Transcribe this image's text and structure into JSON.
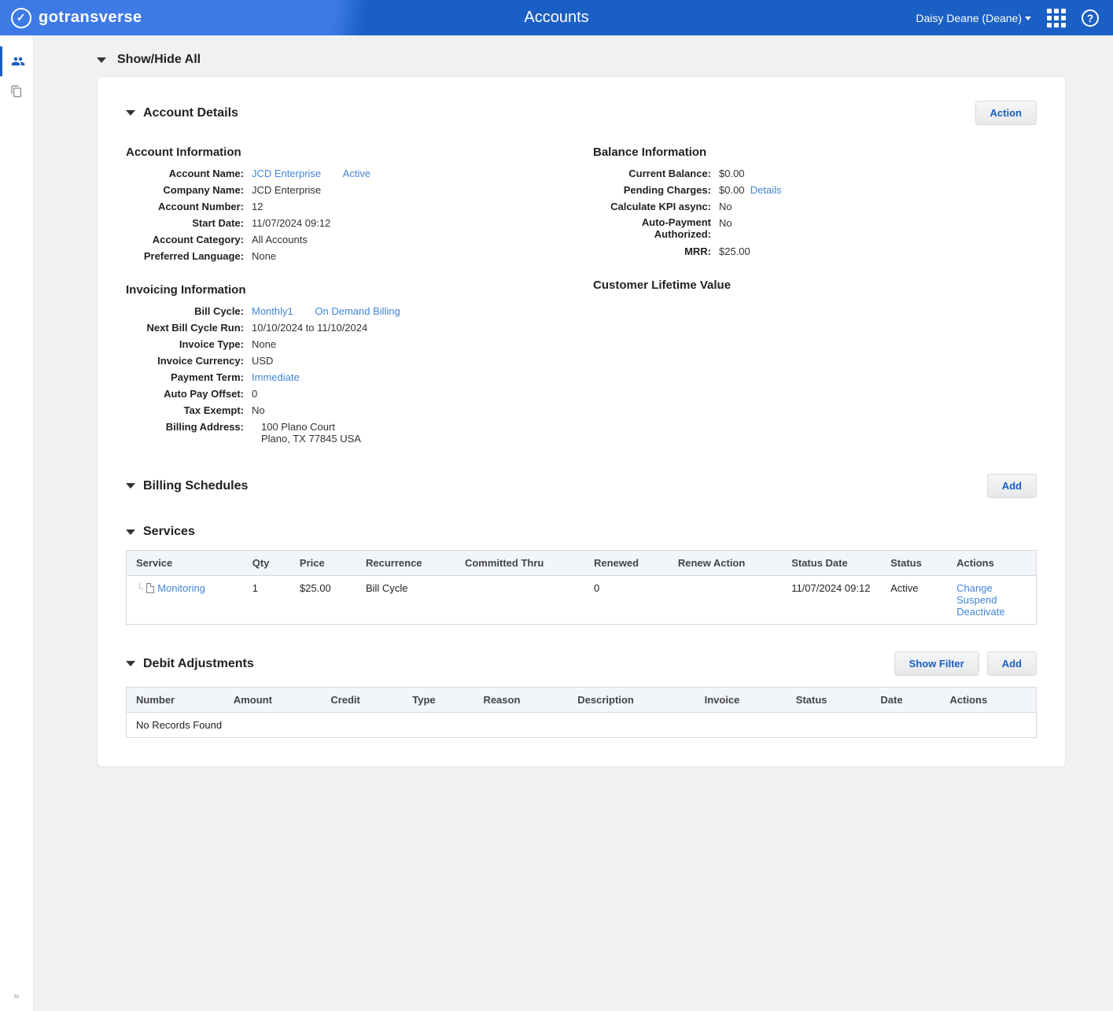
{
  "header": {
    "brand": "gotransverse",
    "page_title": "Accounts",
    "user_label": "Daisy Deane (Deane)"
  },
  "show_hide": {
    "label": "Show/Hide All"
  },
  "account_details": {
    "title": "Account Details",
    "action_label": "Action",
    "account_info": {
      "heading": "Account Information",
      "account_name_label": "Account Name:",
      "account_name": "JCD Enterprise",
      "status": "Active",
      "company_name_label": "Company Name:",
      "company_name": "JCD Enterprise",
      "account_number_label": "Account Number:",
      "account_number": "12",
      "start_date_label": "Start Date:",
      "start_date": "11/07/2024 09:12",
      "category_label": "Account Category:",
      "category": "All Accounts",
      "language_label": "Preferred Language:",
      "language": "None"
    },
    "invoicing": {
      "heading": "Invoicing Information",
      "bill_cycle_label": "Bill Cycle:",
      "bill_cycle": "Monthly1",
      "on_demand": "On Demand Billing",
      "next_run_label": "Next Bill Cycle Run:",
      "next_run": "10/10/2024 to 11/10/2024",
      "invoice_type_label": "Invoice Type:",
      "invoice_type": "None",
      "currency_label": "Invoice Currency:",
      "currency": "USD",
      "payment_term_label": "Payment Term:",
      "payment_term": "Immediate",
      "auto_pay_offset_label": "Auto Pay Offset:",
      "auto_pay_offset": "0",
      "tax_exempt_label": "Tax Exempt:",
      "tax_exempt": "No",
      "billing_address_label": "Billing Address:",
      "billing_address_l1": "100 Plano Court",
      "billing_address_l2": "Plano, TX 77845 USA"
    },
    "balance": {
      "heading": "Balance Information",
      "current_label": "Current Balance:",
      "current": "$0.00",
      "pending_label": "Pending Charges:",
      "pending": "$0.00",
      "details_link": "Details",
      "kpi_label": "Calculate KPI async:",
      "kpi": "No",
      "autopay_label": "Auto-Payment Authorized:",
      "autopay": "No",
      "mrr_label": "MRR:",
      "mrr": "$25.00"
    },
    "clv": {
      "heading": "Customer Lifetime Value"
    }
  },
  "billing_schedules": {
    "title": "Billing Schedules",
    "add_label": "Add"
  },
  "services": {
    "title": "Services",
    "cols": {
      "service": "Service",
      "qty": "Qty",
      "price": "Price",
      "recurrence": "Recurrence",
      "committed": "Committed Thru",
      "renewed": "Renewed",
      "renew_action": "Renew Action",
      "status_date": "Status Date",
      "status": "Status",
      "actions": "Actions"
    },
    "row": {
      "name": "Monitoring",
      "qty": "1",
      "price": "$25.00",
      "recurrence": "Bill Cycle",
      "committed": "",
      "renewed": "0",
      "renew_action": "",
      "status_date": "11/07/2024 09:12",
      "status": "Active",
      "action_change": "Change",
      "action_suspend": "Suspend",
      "action_deactivate": "Deactivate"
    }
  },
  "debit": {
    "title": "Debit Adjustments",
    "show_filter": "Show Filter",
    "add_label": "Add",
    "cols": {
      "number": "Number",
      "amount": "Amount",
      "credit": "Credit",
      "type": "Type",
      "reason": "Reason",
      "description": "Description",
      "invoice": "Invoice",
      "status": "Status",
      "date": "Date",
      "actions": "Actions"
    },
    "empty": "No Records Found"
  }
}
